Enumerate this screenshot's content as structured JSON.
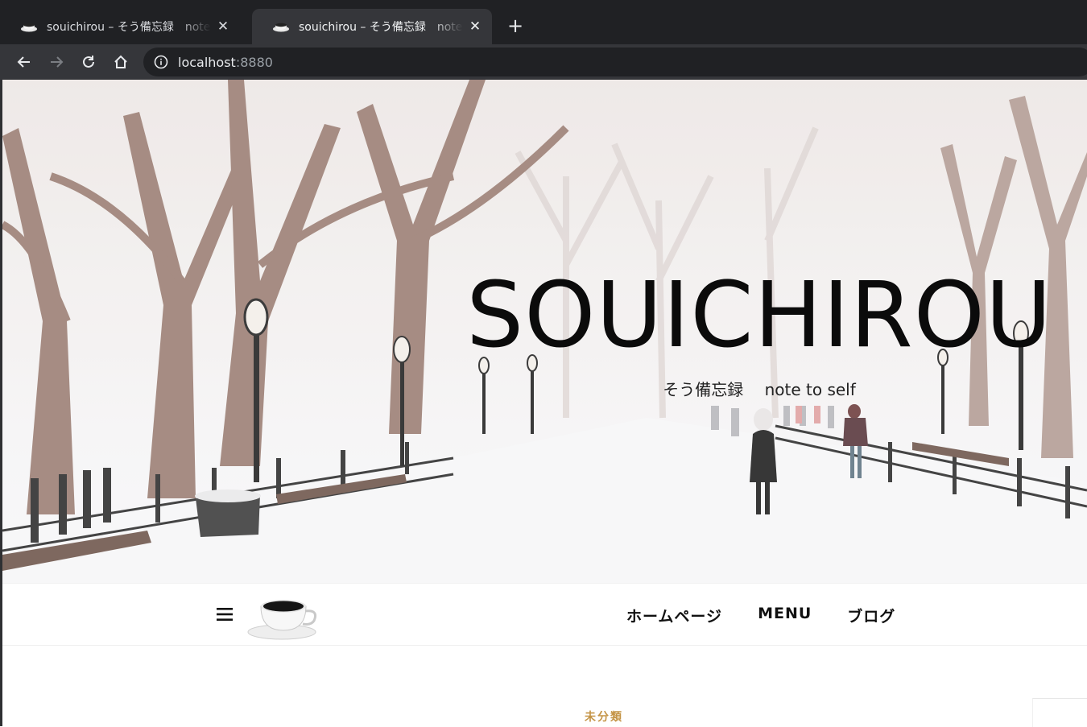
{
  "browser": {
    "tabs": [
      {
        "title": "souichirou – そう備忘録　note to self",
        "active": false
      },
      {
        "title": "souichirou – そう備忘録　note to self",
        "active": true
      }
    ],
    "new_tab_symbol": "+",
    "close_symbol": "✕",
    "address": {
      "host": "localhost",
      "port": ":8880"
    },
    "icons": [
      "back-arrow-icon",
      "forward-arrow-icon",
      "reload-icon",
      "home-icon",
      "info-icon",
      "coffee-cup-favicon"
    ]
  },
  "site": {
    "title": "SOUICHIROU",
    "tagline": "そう備忘録　 note to self",
    "nav": {
      "items": [
        "ホームページ",
        "MENU",
        "ブログ"
      ]
    },
    "post": {
      "category": "未分類"
    }
  },
  "colors": {
    "tab_bar": "#202124",
    "toolbar": "#35363a",
    "category_accent": "#c49446",
    "title_text": "#0b0b0b"
  }
}
